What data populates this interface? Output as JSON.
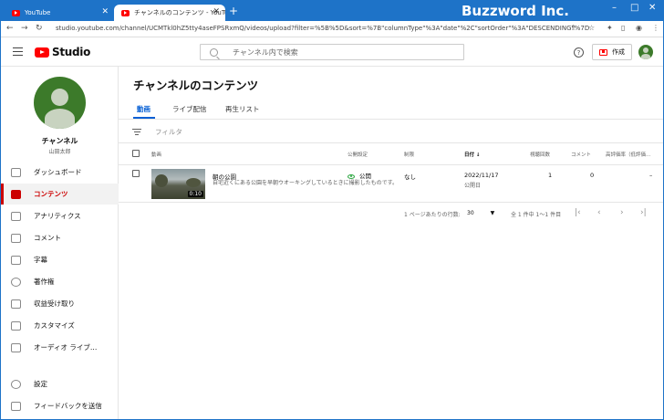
{
  "browser": {
    "tabs": [
      {
        "label": "YouTube"
      },
      {
        "label": "チャンネルのコンテンツ - YouTube Stu"
      }
    ],
    "url": "studio.youtube.com/channel/UCMTkl0hZ5tty4aseFPSRxmQ/videos/upload?filter=%5B%5D&sort=%7B\"columnType\"%3A\"date\"%2C\"sortOrder\"%3A\"DESCENDING\"%7D",
    "brand_overlay": "Buzzword Inc."
  },
  "header": {
    "logo_text": "Studio",
    "search_placeholder": "チャンネル内で検索",
    "help": "?",
    "create_label": "作成"
  },
  "sidebar": {
    "channel_title": "チャンネル",
    "channel_owner": "山田太郎",
    "items": [
      {
        "label": "ダッシュボード"
      },
      {
        "label": "コンテンツ"
      },
      {
        "label": "アナリティクス"
      },
      {
        "label": "コメント"
      },
      {
        "label": "字幕"
      },
      {
        "label": "著作権"
      },
      {
        "label": "収益受け取り"
      },
      {
        "label": "カスタマイズ"
      },
      {
        "label": "オーディオ ライブ…"
      }
    ],
    "footer": [
      {
        "label": "設定"
      },
      {
        "label": "フィードバックを送信"
      }
    ]
  },
  "main": {
    "page_title": "チャンネルのコンテンツ",
    "tabs": [
      {
        "label": "動画"
      },
      {
        "label": "ライブ配信"
      },
      {
        "label": "再生リスト"
      }
    ],
    "filter_placeholder": "フィルタ",
    "columns": {
      "video": "動画",
      "visibility": "公開設定",
      "restrictions": "制限",
      "date": "日付 ↓",
      "views": "視聴回数",
      "comments": "コメント",
      "likes": "高評価率（低評価…"
    },
    "rows": [
      {
        "duration": "0:10",
        "title": "朝の公園",
        "description": "自宅近くにある公園を早朝ウオーキングしているときに撮影したものです。",
        "visibility": "公開",
        "restrictions": "なし",
        "date": "2022/11/17",
        "date_status": "公開日",
        "views": "1",
        "comments": "0",
        "likes": "–"
      }
    ],
    "pagination": {
      "rows_per_page_label": "1 ページあたりの行数:",
      "rows_per_page": "30",
      "range": "全 1 件中 1～1 件目"
    }
  }
}
